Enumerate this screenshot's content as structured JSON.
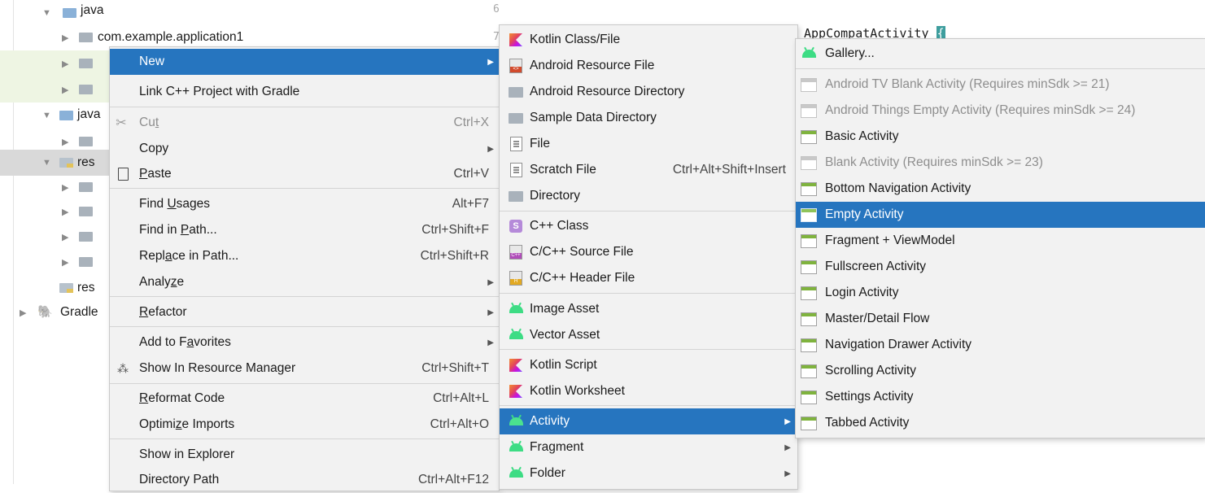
{
  "tree": {
    "rows": [
      {
        "label": "java"
      },
      {
        "label": "com.example.application1"
      },
      {
        "label": ""
      },
      {
        "label": ""
      },
      {
        "label": "java"
      },
      {
        "label": ""
      },
      {
        "label": "res"
      },
      {
        "label": ""
      },
      {
        "label": ""
      },
      {
        "label": ""
      },
      {
        "label": ""
      },
      {
        "label": "res"
      },
      {
        "label": "Gradle"
      }
    ]
  },
  "editor": {
    "gutter_numbers": [
      "6",
      "7"
    ],
    "code_line": "AppCompatActivity",
    "code_brace": "{"
  },
  "context_menu": {
    "items": [
      {
        "label": "New",
        "shortcut": "",
        "submenu": true,
        "highlighted": true
      },
      {
        "label": "Link C++ Project with Gradle",
        "shortcut": ""
      },
      {
        "label_pre": "Cu",
        "label_u": "t",
        "label_post": "",
        "shortcut": "Ctrl+X",
        "icon": "scissors-icon",
        "disabled": true
      },
      {
        "label": "Copy",
        "shortcut": "",
        "submenu": true
      },
      {
        "label_pre": "",
        "label_u": "P",
        "label_post": "aste",
        "shortcut": "Ctrl+V",
        "icon": "clipboard-icon"
      },
      {
        "label_pre": "Find ",
        "label_u": "U",
        "label_post": "sages",
        "shortcut": "Alt+F7"
      },
      {
        "label_pre": "Find in ",
        "label_u": "P",
        "label_post": "ath...",
        "shortcut": "Ctrl+Shift+F"
      },
      {
        "label_pre": "Repl",
        "label_u": "a",
        "label_post": "ce in Path...",
        "shortcut": "Ctrl+Shift+R"
      },
      {
        "label_pre": "Analy",
        "label_u": "z",
        "label_post": "e",
        "shortcut": "",
        "submenu": true
      },
      {
        "label_pre": "",
        "label_u": "R",
        "label_post": "efactor",
        "shortcut": "",
        "submenu": true
      },
      {
        "label_pre": "Add to F",
        "label_u": "a",
        "label_post": "vorites",
        "shortcut": "",
        "submenu": true
      },
      {
        "label": "Show In Resource Manager",
        "shortcut": "Ctrl+Shift+T",
        "icon": "resource-manager-icon"
      },
      {
        "label_pre": "",
        "label_u": "R",
        "label_post": "eformat Code",
        "shortcut": "Ctrl+Alt+L"
      },
      {
        "label_pre": "Optimi",
        "label_u": "z",
        "label_post": "e Imports",
        "shortcut": "Ctrl+Alt+O"
      },
      {
        "label": "Show in Explorer",
        "shortcut": ""
      },
      {
        "label": "Directory Path",
        "shortcut": "Ctrl+Alt+F12"
      }
    ]
  },
  "new_menu": {
    "items": [
      {
        "label": "Kotlin Class/File",
        "icon": "kotlin-icon"
      },
      {
        "label": "Android Resource File",
        "icon": "android-resource-file-icon"
      },
      {
        "label": "Android Resource Directory",
        "icon": "folder-icon"
      },
      {
        "label": "Sample Data Directory",
        "icon": "folder-icon"
      },
      {
        "label": "File",
        "icon": "file-icon"
      },
      {
        "label": "Scratch File",
        "shortcut": "Ctrl+Alt+Shift+Insert",
        "icon": "scratch-file-icon"
      },
      {
        "label": "Directory",
        "icon": "folder-icon"
      },
      {
        "label": "C++ Class",
        "icon": "cpp-class-icon",
        "badge": "S"
      },
      {
        "label": "C/C++ Source File",
        "icon": "cpp-source-icon",
        "badge": "C++"
      },
      {
        "label": "C/C++ Header File",
        "icon": "cpp-header-icon",
        "badge": "H"
      },
      {
        "label": "Image Asset",
        "icon": "android-icon"
      },
      {
        "label": "Vector Asset",
        "icon": "android-icon"
      },
      {
        "label": "Kotlin Script",
        "icon": "kotlin-icon"
      },
      {
        "label": "Kotlin Worksheet",
        "icon": "kotlin-icon"
      },
      {
        "label": "Activity",
        "icon": "android-icon",
        "submenu": true,
        "highlighted": true
      },
      {
        "label": "Fragment",
        "icon": "android-icon",
        "submenu": true
      },
      {
        "label": "Folder",
        "icon": "android-icon",
        "submenu": true
      }
    ]
  },
  "activity_menu": {
    "items": [
      {
        "label": "Gallery...",
        "icon": "android-icon"
      },
      {
        "label": "Android TV Blank Activity (Requires minSdk >= 21)",
        "disabled": true
      },
      {
        "label": "Android Things Empty Activity (Requires minSdk >= 24)",
        "disabled": true
      },
      {
        "label": "Basic Activity"
      },
      {
        "label": "Blank Activity (Requires minSdk >= 23)",
        "disabled": true
      },
      {
        "label": "Bottom Navigation Activity"
      },
      {
        "label": "Empty Activity",
        "highlighted": true
      },
      {
        "label": "Fragment + ViewModel"
      },
      {
        "label": "Fullscreen Activity"
      },
      {
        "label": "Login Activity"
      },
      {
        "label": "Master/Detail Flow"
      },
      {
        "label": "Navigation Drawer Activity"
      },
      {
        "label": "Scrolling Activity"
      },
      {
        "label": "Settings Activity"
      },
      {
        "label": "Tabbed Activity"
      }
    ]
  },
  "colors": {
    "highlight": "#2675bf",
    "menu_bg": "#f2f2f2",
    "android_green": "#3ddc84",
    "tree_selected_green": "#eef5e3",
    "tree_selected_gray": "#d9d9d9"
  }
}
